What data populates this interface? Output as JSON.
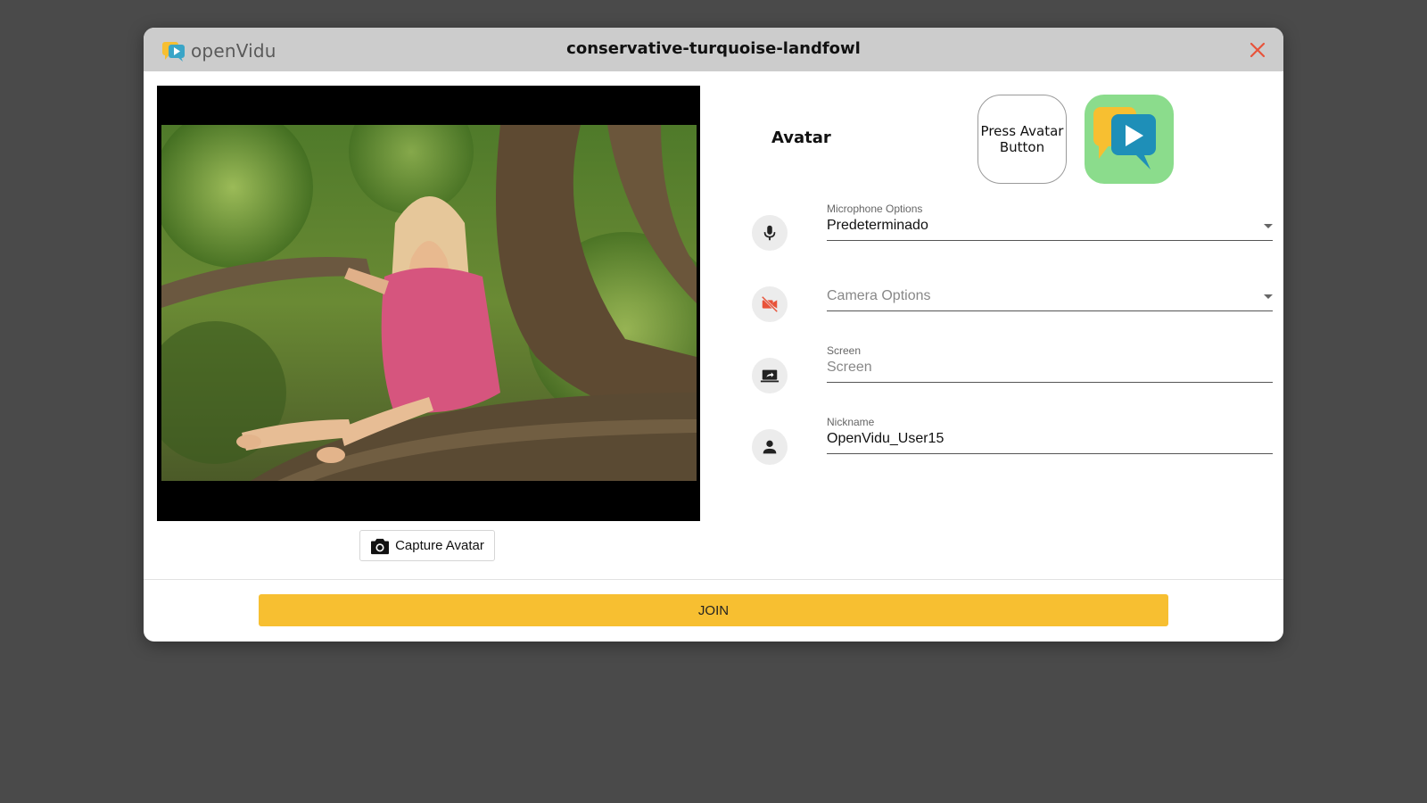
{
  "app": {
    "logo_text": "openVidu",
    "title": "conservative-turquoise-landfowl"
  },
  "preview": {
    "capture_label": "Capture Avatar"
  },
  "avatar": {
    "label": "Avatar",
    "button_label": "Press Avatar Button"
  },
  "microphone": {
    "label": "Microphone Options",
    "value": "Predeterminado",
    "icon": "mic-icon"
  },
  "camera": {
    "placeholder": "Camera Options",
    "icon": "videocam-off-icon",
    "status_color": "#e8533a"
  },
  "screen": {
    "label": "Screen",
    "placeholder": "Screen",
    "icon": "screen-share-icon"
  },
  "nickname": {
    "label": "Nickname",
    "value": "OpenVidu_User15",
    "icon": "person-icon"
  },
  "footer": {
    "join_label": "JOIN"
  },
  "colors": {
    "accent": "#f7bf31",
    "close": "#e8533a",
    "header_bg": "#cccccc",
    "page_bg": "#4a4a4a"
  }
}
